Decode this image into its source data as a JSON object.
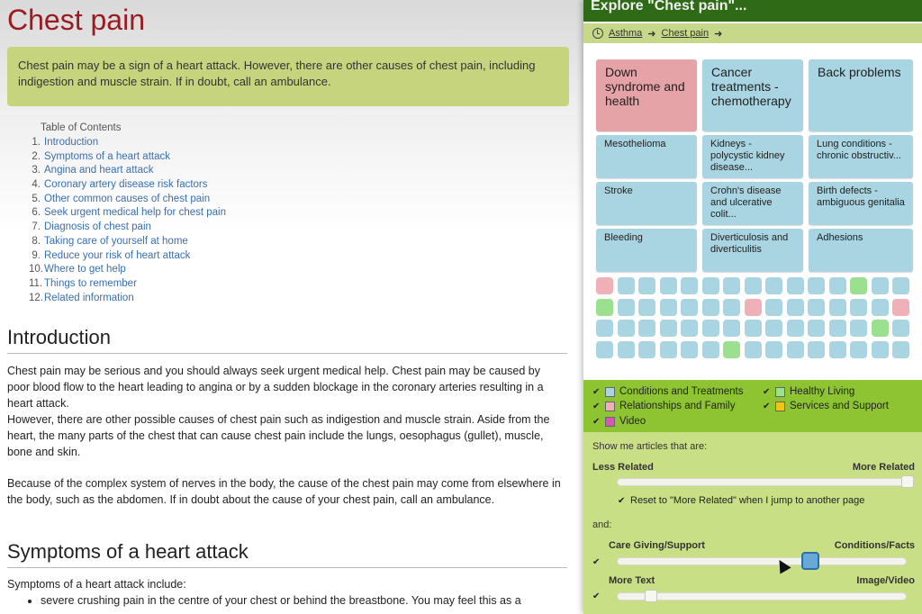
{
  "article": {
    "title": "Chest pain",
    "alert": "Chest pain may be a sign of a heart attack. However, there are other causes of chest pain, including indigestion and muscle strain. If in doubt, call an ambulance.",
    "toc_title": "Table of Contents",
    "toc": [
      {
        "num": "1.",
        "label": "Introduction"
      },
      {
        "num": "2.",
        "label": "Symptoms of a heart attack"
      },
      {
        "num": "3.",
        "label": "Angina and heart attack"
      },
      {
        "num": "4.",
        "label": "Coronary artery disease risk factors"
      },
      {
        "num": "5.",
        "label": "Other common causes of chest pain"
      },
      {
        "num": "6.",
        "label": "Seek urgent medical help for chest pain"
      },
      {
        "num": "7.",
        "label": "Diagnosis of chest pain"
      },
      {
        "num": "8.",
        "label": "Taking care of yourself at home"
      },
      {
        "num": "9.",
        "label": "Reduce your risk of heart attack"
      },
      {
        "num": "10.",
        "label": "Where to get help"
      },
      {
        "num": "11.",
        "label": "Things to remember"
      },
      {
        "num": "12.",
        "label": "Related information"
      }
    ],
    "intro_heading": "Introduction",
    "intro_p1": "Chest pain may be serious and you should always seek urgent medical help. Chest pain may be caused by poor blood flow to the heart leading to angina or by a sudden blockage in the coronary arteries resulting in a heart attack.",
    "intro_p2": "However, there are other possible causes of chest pain such as indigestion and muscle strain. Aside from the heart, the many parts of the chest that can cause chest pain include the lungs, oesophagus (gullet), muscle, bone and skin.",
    "intro_p3": "Because of the complex system of nerves in the body, the cause of the chest pain may come from elsewhere in the body, such as the abdomen. If in doubt about the cause of your chest pain, call an ambulance.",
    "symptoms_heading": "Symptoms of a heart attack",
    "symptoms_intro": "Symptoms of a heart attack include:",
    "symptoms_list": [
      "severe crushing pain in the centre of your chest or behind the breastbone. You may feel this as a"
    ]
  },
  "panel": {
    "title": "Explore \"Chest pain\"...",
    "breadcrumbs": [
      "Asthma",
      "Chest pain"
    ],
    "big_tiles": [
      {
        "label": "Down syndrome and health",
        "category": "pink"
      },
      {
        "label": "Cancer treatments - chemotherapy",
        "category": "blue"
      },
      {
        "label": "Back problems",
        "category": "blue"
      }
    ],
    "small_tiles": [
      "Mesothelioma",
      "Kidneys - polycystic kidney disease...",
      "Lung conditions - chronic obstructiv...",
      "Stroke",
      "Crohn's disease and ulcerative colit...",
      "Birth defects - ambiguous genitalia",
      "Bleeding",
      "Diverticulosis and diverticulitis",
      "Adhesions"
    ],
    "dot_rows": [
      [
        "pink",
        "blue",
        "blue",
        "blue",
        "blue",
        "blue",
        "blue",
        "blue",
        "blue",
        "blue",
        "blue",
        "blue",
        "green",
        "blue",
        "blue"
      ],
      [
        "green",
        "blue",
        "blue",
        "blue",
        "blue",
        "blue",
        "blue",
        "pink",
        "blue",
        "blue",
        "blue",
        "blue",
        "blue",
        "blue",
        "pink"
      ],
      [
        "blue",
        "blue",
        "blue",
        "blue",
        "blue",
        "blue",
        "blue",
        "blue",
        "blue",
        "blue",
        "blue",
        "blue",
        "blue",
        "green",
        "blue"
      ],
      [
        "blue",
        "blue",
        "blue",
        "blue",
        "blue",
        "blue",
        "green",
        "blue",
        "blue",
        "blue",
        "blue",
        "blue",
        "blue",
        "blue",
        "blue"
      ]
    ],
    "filters": [
      {
        "label": "Conditions and Treatments",
        "color": "#a9d4e1",
        "checked": true
      },
      {
        "label": "Healthy Living",
        "color": "#9be08f",
        "checked": true
      },
      {
        "label": "Relationships and Family",
        "color": "#efb1b7",
        "checked": true
      },
      {
        "label": "Services and Support",
        "color": "#f2c417",
        "checked": true
      },
      {
        "label": "Video",
        "color": "#d957b3",
        "checked": true
      }
    ],
    "show_me": "Show me articles that are:",
    "related_less": "Less Related",
    "related_more": "More Related",
    "related_value": 1.0,
    "reset_label": "Reset to \"More Related\" when I jump to another page",
    "and_label": "and:",
    "care_left": "Care Giving/Support",
    "care_right": "Conditions/Facts",
    "care_value": 0.68,
    "text_left": "More Text",
    "text_right": "Image/Video",
    "text_value": 0.1,
    "checkmark": "✔",
    "colors": {
      "header": "#2f6b17",
      "filters_bg": "#8ec431",
      "tile_blue": "#a9d4e1",
      "tile_pink": "#e5a2a7",
      "dot_green": "#9be08f"
    }
  }
}
